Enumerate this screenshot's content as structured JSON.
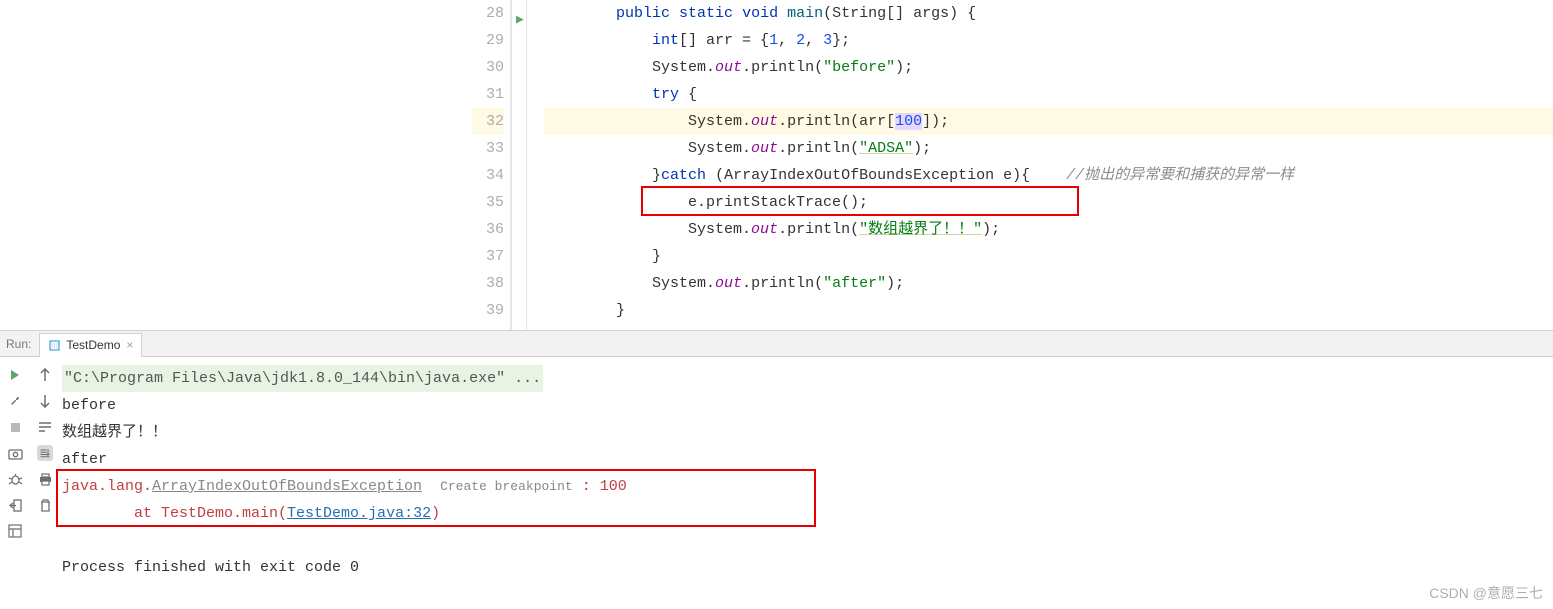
{
  "editor": {
    "lines": [
      {
        "num": 28
      },
      {
        "num": 29
      },
      {
        "num": 30
      },
      {
        "num": 31
      },
      {
        "num": 32,
        "highlight": true
      },
      {
        "num": 33
      },
      {
        "num": 34
      },
      {
        "num": 35
      },
      {
        "num": 36
      },
      {
        "num": 37
      },
      {
        "num": 38
      },
      {
        "num": 39
      }
    ],
    "code": {
      "l28": {
        "kw1": "public",
        "kw2": "static",
        "kw3": "void",
        "mth": "main",
        "txt1": "(String[] args) {"
      },
      "l29": {
        "kw": "int",
        "txt1": "[] arr = {",
        "n1": "1",
        "c1": ", ",
        "n2": "2",
        "c2": ", ",
        "n3": "3",
        "txt2": "};"
      },
      "l30": {
        "txt1": "System.",
        "fld": "out",
        "txt2": ".println(",
        "str": "\"before\"",
        "txt3": ");"
      },
      "l31": {
        "kw": "try",
        "txt": " {"
      },
      "l32": {
        "txt1": "System.",
        "fld": "out",
        "txt2": ".println(arr[",
        "num": "100",
        "txt3": "]);"
      },
      "l33": {
        "txt1": "System.",
        "fld": "out",
        "txt2": ".println(",
        "str": "\"ADSA\"",
        "txt3": ");"
      },
      "l34": {
        "txt1": "}",
        "kw": "catch",
        "txt2": " (ArrayIndexOutOfBoundsException e){    ",
        "cmt": "//抛出的异常要和捕获的异常一样"
      },
      "l35": {
        "txt": "e.printStackTrace();"
      },
      "l36": {
        "txt1": "System.",
        "fld": "out",
        "txt2": ".println(",
        "str": "\"数组越界了！！\"",
        "txt3": ");"
      },
      "l37": {
        "txt": "}"
      },
      "l38": {
        "txt1": "System.",
        "fld": "out",
        "txt2": ".println(",
        "str": "\"after\"",
        "txt3": ");"
      },
      "l39": {
        "txt": "}"
      }
    }
  },
  "run": {
    "label": "Run:",
    "tab_name": "TestDemo",
    "console": {
      "cmd": "\"C:\\Program Files\\Java\\jdk1.8.0_144\\bin\\java.exe\" ...",
      "out1": "before",
      "out2": "数组越界了！！",
      "out3": "after",
      "err_prefix": "java.lang.",
      "err_class": "ArrayIndexOutOfBoundsException",
      "bp_label": "Create breakpoint",
      "err_suffix": " : 100",
      "trace_prefix": "\tat TestDemo.main(",
      "trace_link": "TestDemo.java:32",
      "trace_suffix": ")",
      "exit": "Process finished with exit code 0"
    }
  },
  "watermark": "CSDN @意愿三七"
}
